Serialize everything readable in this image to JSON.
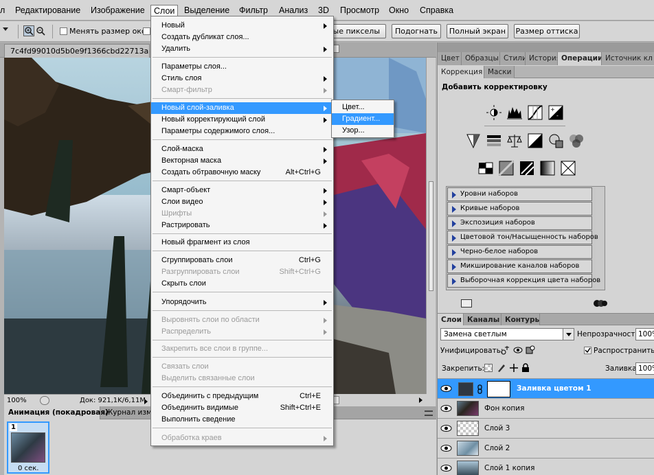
{
  "menubar": {
    "items": [
      "л",
      "Редактирование",
      "Изображение",
      "Слои",
      "Выделение",
      "Фильтр",
      "Анализ",
      "3D",
      "Просмотр",
      "Окно",
      "Справка"
    ]
  },
  "options_bar": {
    "resize_windows": "Менять размер окон",
    "actual_pixels": "Реальные пикселы",
    "fit_screen": "Подогнать",
    "full_screen": "Полный экран",
    "print_size": "Размер оттиска"
  },
  "document": {
    "tab_title": "7c4fd99010d5b0e9f1366cbd22713a",
    "zoom": "100%",
    "doc_info": "Док: 921,1K/6,11M"
  },
  "animation_panel": {
    "tab_animation": "Анимация (покадровая)",
    "tab_history": "Журнал изме",
    "frame_number": "1",
    "frame_delay": "0 сек."
  },
  "layers_menu": {
    "items": [
      {
        "label": "Новый",
        "arrow": true
      },
      {
        "label": "Создать дубликат слоя...",
        "shortcut": ""
      },
      {
        "label": "Удалить",
        "arrow": true
      },
      {
        "label": "Параметры слоя..."
      },
      {
        "label": "Стиль слоя",
        "arrow": true
      },
      {
        "label": "Смарт-фильтр",
        "arrow": true,
        "disabled": true
      },
      {
        "label": "Новый слой-заливка",
        "arrow": true,
        "highlighted": true
      },
      {
        "label": "Новый корректирующий слой",
        "arrow": true
      },
      {
        "label": "Параметры содержимого слоя..."
      },
      {
        "label": "Слой-маска",
        "arrow": true
      },
      {
        "label": "Векторная маска",
        "arrow": true
      },
      {
        "label": "Создать обтравочную маску",
        "shortcut": "Alt+Ctrl+G"
      },
      {
        "label": "Смарт-объект",
        "arrow": true
      },
      {
        "label": "Слои видео",
        "arrow": true
      },
      {
        "label": "Шрифты",
        "arrow": true,
        "disabled": true
      },
      {
        "label": "Растрировать",
        "arrow": true
      },
      {
        "label": "Новый фрагмент из слоя"
      },
      {
        "label": "Сгруппировать слои",
        "shortcut": "Ctrl+G"
      },
      {
        "label": "Разгруппировать слои",
        "shortcut": "Shift+Ctrl+G",
        "disabled": true
      },
      {
        "label": "Скрыть слои"
      },
      {
        "label": "Упорядочить",
        "arrow": true
      },
      {
        "label": "Выровнять слои по области",
        "arrow": true,
        "disabled": true
      },
      {
        "label": "Распределить",
        "arrow": true,
        "disabled": true
      },
      {
        "label": "Закрепить все слои в группе...",
        "disabled": true
      },
      {
        "label": "Связать слои",
        "disabled": true
      },
      {
        "label": "Выделить связанные слои",
        "disabled": true
      },
      {
        "label": "Объединить с предыдущим",
        "shortcut": "Ctrl+E"
      },
      {
        "label": "Объединить видимые",
        "shortcut": "Shift+Ctrl+E"
      },
      {
        "label": "Выполнить сведение"
      },
      {
        "label": "Обработка краев",
        "arrow": true,
        "disabled": true
      }
    ]
  },
  "fill_submenu": {
    "items": [
      {
        "label": "Цвет..."
      },
      {
        "label": "Градиент...",
        "highlighted": true
      },
      {
        "label": "Узор..."
      }
    ]
  },
  "top_panel": {
    "tabs": [
      "Цвет",
      "Образцы",
      "Стили",
      "История",
      "Операции",
      "Источник кл"
    ],
    "subtabs": [
      "Коррекция",
      "Маски"
    ],
    "heading": "Добавить корректировку",
    "presets": [
      "Уровни наборов",
      "Кривые наборов",
      "Экспозиция наборов",
      "Цветовой тон/Насыщенность наборов",
      "Черно-белое наборов",
      "Микширование каналов наборов",
      "Выборочная коррекция цвета наборов"
    ]
  },
  "layers_panel": {
    "tabs": [
      "Слои",
      "Каналы",
      "Контуры"
    ],
    "blend_mode": "Замена светлым",
    "opacity_label": "Непрозрачность:",
    "opacity_value": "100%",
    "unify_label": "Унифицировать:",
    "propagate_label": "Распространить к",
    "lock_label": "Закрепить:",
    "fill_label": "Заливка:",
    "fill_value": "100%",
    "layers": [
      "Заливка цветом 1",
      "Фон копия",
      "Слой 3",
      "Слой 2",
      "Слой 1 копия"
    ],
    "selected_layer": "Заливка цветом 1"
  },
  "colors": {
    "highlight": "#3399ff",
    "menu_bg": "#f5f5f5",
    "panel_bg": "#d4d4d4"
  }
}
